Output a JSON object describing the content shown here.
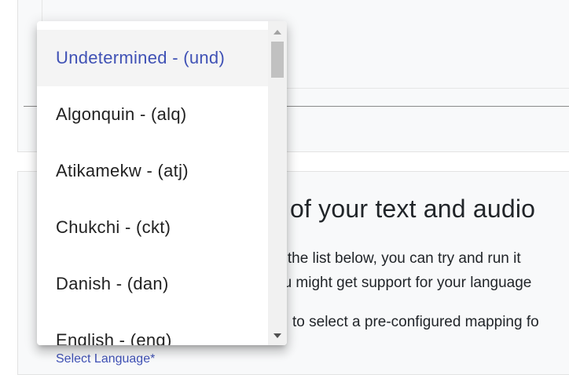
{
  "dropdown": {
    "options": [
      {
        "label": "Undetermined - (und)",
        "selected": true
      },
      {
        "label": "Algonquin - (alq)",
        "selected": false
      },
      {
        "label": "Atikamekw - (atj)",
        "selected": false
      },
      {
        "label": "Chukchi - (ckt)",
        "selected": false
      },
      {
        "label": "Danish - (dan)",
        "selected": false
      },
      {
        "label": "English - (eng)",
        "selected": false
      }
    ]
  },
  "section": {
    "title": "of your text and audio",
    "line1": "n the list below, you can try and run it",
    "line2": "ou might get support for your language",
    "line3": "to select a pre-configured mapping fo",
    "select_label": "Select Language*"
  },
  "colors": {
    "accent": "#3f51b5",
    "text": "#212529",
    "card_bg": "#f8f9fa"
  },
  "icons": {
    "scroll_up": "triangle-up",
    "scroll_down": "triangle-down"
  }
}
